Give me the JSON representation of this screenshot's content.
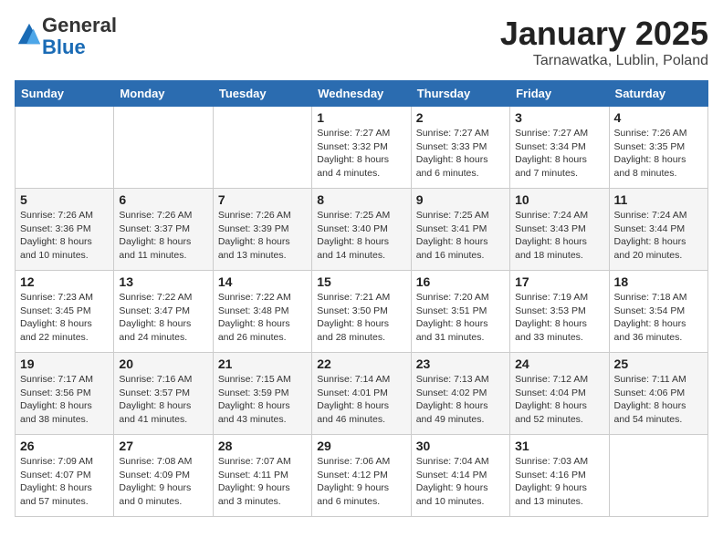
{
  "logo": {
    "general": "General",
    "blue": "Blue"
  },
  "header": {
    "month": "January 2025",
    "location": "Tarnawatka, Lublin, Poland"
  },
  "days_of_week": [
    "Sunday",
    "Monday",
    "Tuesday",
    "Wednesday",
    "Thursday",
    "Friday",
    "Saturday"
  ],
  "weeks": [
    [
      {
        "day": "",
        "info": ""
      },
      {
        "day": "",
        "info": ""
      },
      {
        "day": "",
        "info": ""
      },
      {
        "day": "1",
        "info": "Sunrise: 7:27 AM\nSunset: 3:32 PM\nDaylight: 8 hours and 4 minutes."
      },
      {
        "day": "2",
        "info": "Sunrise: 7:27 AM\nSunset: 3:33 PM\nDaylight: 8 hours and 6 minutes."
      },
      {
        "day": "3",
        "info": "Sunrise: 7:27 AM\nSunset: 3:34 PM\nDaylight: 8 hours and 7 minutes."
      },
      {
        "day": "4",
        "info": "Sunrise: 7:26 AM\nSunset: 3:35 PM\nDaylight: 8 hours and 8 minutes."
      }
    ],
    [
      {
        "day": "5",
        "info": "Sunrise: 7:26 AM\nSunset: 3:36 PM\nDaylight: 8 hours and 10 minutes."
      },
      {
        "day": "6",
        "info": "Sunrise: 7:26 AM\nSunset: 3:37 PM\nDaylight: 8 hours and 11 minutes."
      },
      {
        "day": "7",
        "info": "Sunrise: 7:26 AM\nSunset: 3:39 PM\nDaylight: 8 hours and 13 minutes."
      },
      {
        "day": "8",
        "info": "Sunrise: 7:25 AM\nSunset: 3:40 PM\nDaylight: 8 hours and 14 minutes."
      },
      {
        "day": "9",
        "info": "Sunrise: 7:25 AM\nSunset: 3:41 PM\nDaylight: 8 hours and 16 minutes."
      },
      {
        "day": "10",
        "info": "Sunrise: 7:24 AM\nSunset: 3:43 PM\nDaylight: 8 hours and 18 minutes."
      },
      {
        "day": "11",
        "info": "Sunrise: 7:24 AM\nSunset: 3:44 PM\nDaylight: 8 hours and 20 minutes."
      }
    ],
    [
      {
        "day": "12",
        "info": "Sunrise: 7:23 AM\nSunset: 3:45 PM\nDaylight: 8 hours and 22 minutes."
      },
      {
        "day": "13",
        "info": "Sunrise: 7:22 AM\nSunset: 3:47 PM\nDaylight: 8 hours and 24 minutes."
      },
      {
        "day": "14",
        "info": "Sunrise: 7:22 AM\nSunset: 3:48 PM\nDaylight: 8 hours and 26 minutes."
      },
      {
        "day": "15",
        "info": "Sunrise: 7:21 AM\nSunset: 3:50 PM\nDaylight: 8 hours and 28 minutes."
      },
      {
        "day": "16",
        "info": "Sunrise: 7:20 AM\nSunset: 3:51 PM\nDaylight: 8 hours and 31 minutes."
      },
      {
        "day": "17",
        "info": "Sunrise: 7:19 AM\nSunset: 3:53 PM\nDaylight: 8 hours and 33 minutes."
      },
      {
        "day": "18",
        "info": "Sunrise: 7:18 AM\nSunset: 3:54 PM\nDaylight: 8 hours and 36 minutes."
      }
    ],
    [
      {
        "day": "19",
        "info": "Sunrise: 7:17 AM\nSunset: 3:56 PM\nDaylight: 8 hours and 38 minutes."
      },
      {
        "day": "20",
        "info": "Sunrise: 7:16 AM\nSunset: 3:57 PM\nDaylight: 8 hours and 41 minutes."
      },
      {
        "day": "21",
        "info": "Sunrise: 7:15 AM\nSunset: 3:59 PM\nDaylight: 8 hours and 43 minutes."
      },
      {
        "day": "22",
        "info": "Sunrise: 7:14 AM\nSunset: 4:01 PM\nDaylight: 8 hours and 46 minutes."
      },
      {
        "day": "23",
        "info": "Sunrise: 7:13 AM\nSunset: 4:02 PM\nDaylight: 8 hours and 49 minutes."
      },
      {
        "day": "24",
        "info": "Sunrise: 7:12 AM\nSunset: 4:04 PM\nDaylight: 8 hours and 52 minutes."
      },
      {
        "day": "25",
        "info": "Sunrise: 7:11 AM\nSunset: 4:06 PM\nDaylight: 8 hours and 54 minutes."
      }
    ],
    [
      {
        "day": "26",
        "info": "Sunrise: 7:09 AM\nSunset: 4:07 PM\nDaylight: 8 hours and 57 minutes."
      },
      {
        "day": "27",
        "info": "Sunrise: 7:08 AM\nSunset: 4:09 PM\nDaylight: 9 hours and 0 minutes."
      },
      {
        "day": "28",
        "info": "Sunrise: 7:07 AM\nSunset: 4:11 PM\nDaylight: 9 hours and 3 minutes."
      },
      {
        "day": "29",
        "info": "Sunrise: 7:06 AM\nSunset: 4:12 PM\nDaylight: 9 hours and 6 minutes."
      },
      {
        "day": "30",
        "info": "Sunrise: 7:04 AM\nSunset: 4:14 PM\nDaylight: 9 hours and 10 minutes."
      },
      {
        "day": "31",
        "info": "Sunrise: 7:03 AM\nSunset: 4:16 PM\nDaylight: 9 hours and 13 minutes."
      },
      {
        "day": "",
        "info": ""
      }
    ]
  ]
}
